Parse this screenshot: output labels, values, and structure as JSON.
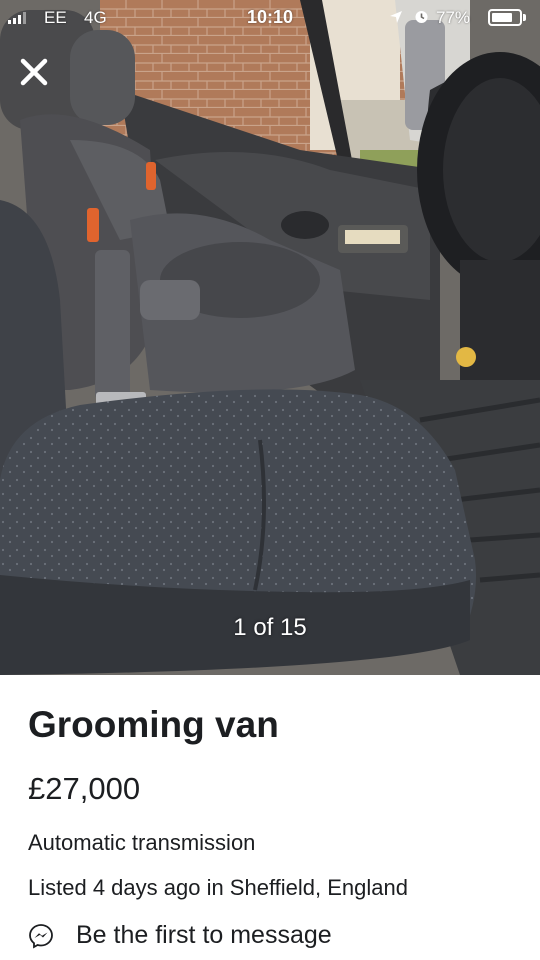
{
  "status_bar": {
    "carrier": "EE",
    "network": "4G",
    "time": "10:10",
    "battery": "77%",
    "battery_level": 0.77,
    "icons": [
      "signal-icon",
      "location-icon",
      "alarm-icon",
      "battery-icon"
    ]
  },
  "viewer": {
    "close_icon": "close-icon",
    "counter": "1 of 15"
  },
  "listing": {
    "title": "Grooming van",
    "price": "£27,000",
    "transmission": "Automatic transmission",
    "listed": "Listed 4 days ago in Sheffield, England",
    "message_cta": "Be the first to message",
    "message_icon": "messenger-icon"
  },
  "colors": {
    "text": "#1c1e21",
    "background": "#ffffff",
    "overlay_text": "#ffffff"
  }
}
